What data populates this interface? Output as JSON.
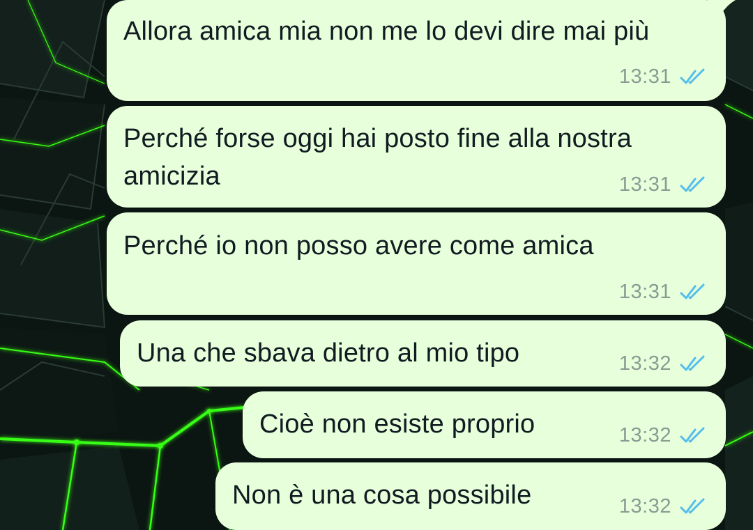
{
  "colors": {
    "bubble_bg": "#e7ffdb",
    "text": "#111b21",
    "time": "#8b9a92",
    "read_ticks": "#53bdeb",
    "wallpaper_bg": "#0b1512",
    "wallpaper_lines": "#39ff14"
  },
  "status_icon": "double-check-read-icon",
  "messages": [
    {
      "text": "Allora amica mia non me lo devi dire mai più",
      "time": "13:31",
      "status": "read"
    },
    {
      "text": "Perché forse oggi hai posto fine alla nostra amicizia",
      "time": "13:31",
      "status": "read"
    },
    {
      "text": "Perché io non posso avere come amica",
      "time": "13:31",
      "status": "read"
    },
    {
      "text": "Una che sbava dietro al mio tipo",
      "time": "13:32",
      "status": "read"
    },
    {
      "text": "Cioè non esiste proprio",
      "time": "13:32",
      "status": "read"
    },
    {
      "text": "Non è una cosa possibile",
      "time": "13:32",
      "status": "read"
    }
  ]
}
